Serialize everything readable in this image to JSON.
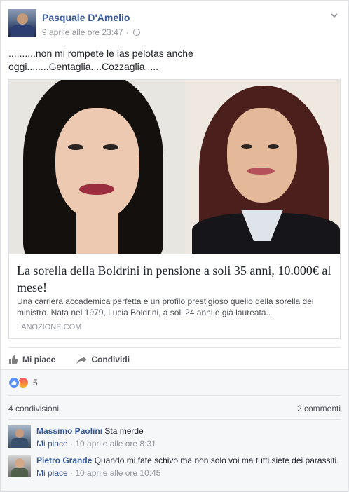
{
  "post": {
    "author": "Pasquale D'Amelio",
    "timestamp": "9 aprile alle ore 23:47",
    "separator": "·",
    "text": "..........non mi rompete le las pelotas anche\noggi........Gentaglia....Cozzaglia....."
  },
  "link_preview": {
    "title": "La sorella della Boldrini in pensione a soli 35 anni, 10.000€ al mese!",
    "description": "Una carriera accademica perfetta e un profilo prestigioso quello della sorella del ministro. Nata nel 1979, Lucia Boldrini, a soli 24 anni è già laureata..",
    "domain": "LANOZIONE.COM"
  },
  "actions": {
    "like": "Mi piace",
    "share": "Condividi"
  },
  "stats": {
    "reactions_count": "5",
    "shares": "4 condivisioni",
    "comments": "2 commenti"
  },
  "comments": [
    {
      "author": "Massimo Paolini",
      "text": "Sta merde",
      "like": "Mi piace",
      "sep": "·",
      "time": "10 aprile alle ore 8:31"
    },
    {
      "author": "Pietro Grande",
      "text": "Quando mi fate schivo ma non solo voi ma tutti.siete dei parassiti.",
      "like": "Mi piace",
      "sep": "·",
      "time": "10 aprile alle ore 10:45"
    }
  ],
  "icons": [
    "chevron-down-icon",
    "globe-icon",
    "thumbs-up-icon",
    "share-arrow-icon",
    "like-reaction-icon",
    "angry-reaction-icon"
  ],
  "colors": {
    "link_blue": "#365899",
    "meta_grey": "#90949c",
    "like_blue": "#5890ff"
  }
}
